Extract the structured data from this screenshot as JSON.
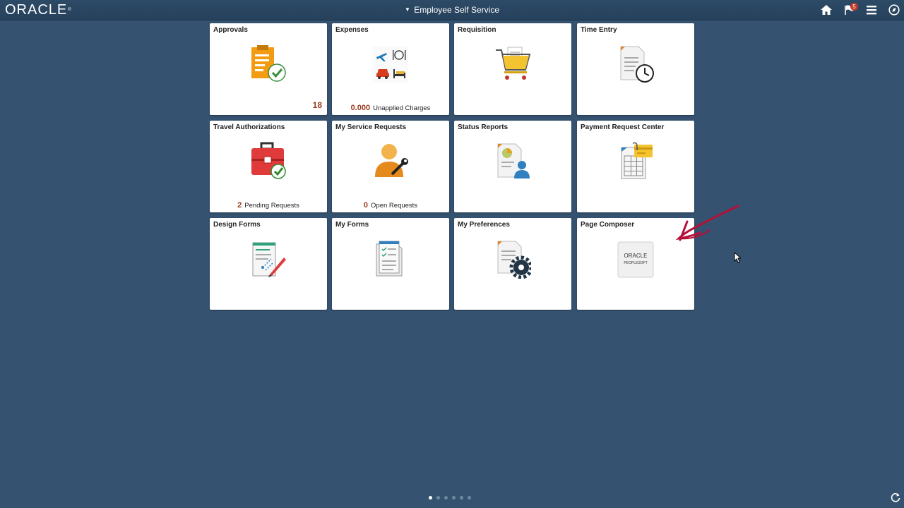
{
  "header": {
    "logo_text": "ORACLE",
    "logo_mark": "®",
    "title_caret": "▼",
    "title": "Employee Self Service",
    "notification_count": "5",
    "icons": [
      "home-icon",
      "notifications-flag-icon",
      "menu-icon",
      "navbar-compass-icon"
    ]
  },
  "tiles": [
    {
      "title": "Approvals",
      "icon": "approvals-icon",
      "count": "18"
    },
    {
      "title": "Expenses",
      "icon": "expenses-icon",
      "footer_number": "0.000",
      "footer_label": "Unapplied Charges"
    },
    {
      "title": "Requisition",
      "icon": "shopping-cart-icon"
    },
    {
      "title": "Time Entry",
      "icon": "timesheet-clock-icon"
    },
    {
      "title": "Travel Authorizations",
      "icon": "briefcase-check-icon",
      "footer_number": "2",
      "footer_label": "Pending Requests"
    },
    {
      "title": "My Service Requests",
      "icon": "person-wrench-icon",
      "footer_number": "0",
      "footer_label": "Open Requests"
    },
    {
      "title": "Status Reports",
      "icon": "report-person-icon"
    },
    {
      "title": "Payment Request Center",
      "icon": "payment-request-icon"
    },
    {
      "title": "Design Forms",
      "icon": "design-forms-icon"
    },
    {
      "title": "My Forms",
      "icon": "my-forms-icon"
    },
    {
      "title": "My Preferences",
      "icon": "preferences-gear-icon"
    },
    {
      "title": "Page Composer",
      "icon": "oracle-peoplesoft-logo",
      "logo_line1": "ORACLE",
      "logo_line2": "PEOPLESOFT"
    }
  ],
  "page_indicator": {
    "count": 6,
    "active": 0
  },
  "colors": {
    "background": "#355370",
    "header": "#2d4a66",
    "tile_count": "#9a3b1d",
    "annotation": "#b4103a"
  }
}
